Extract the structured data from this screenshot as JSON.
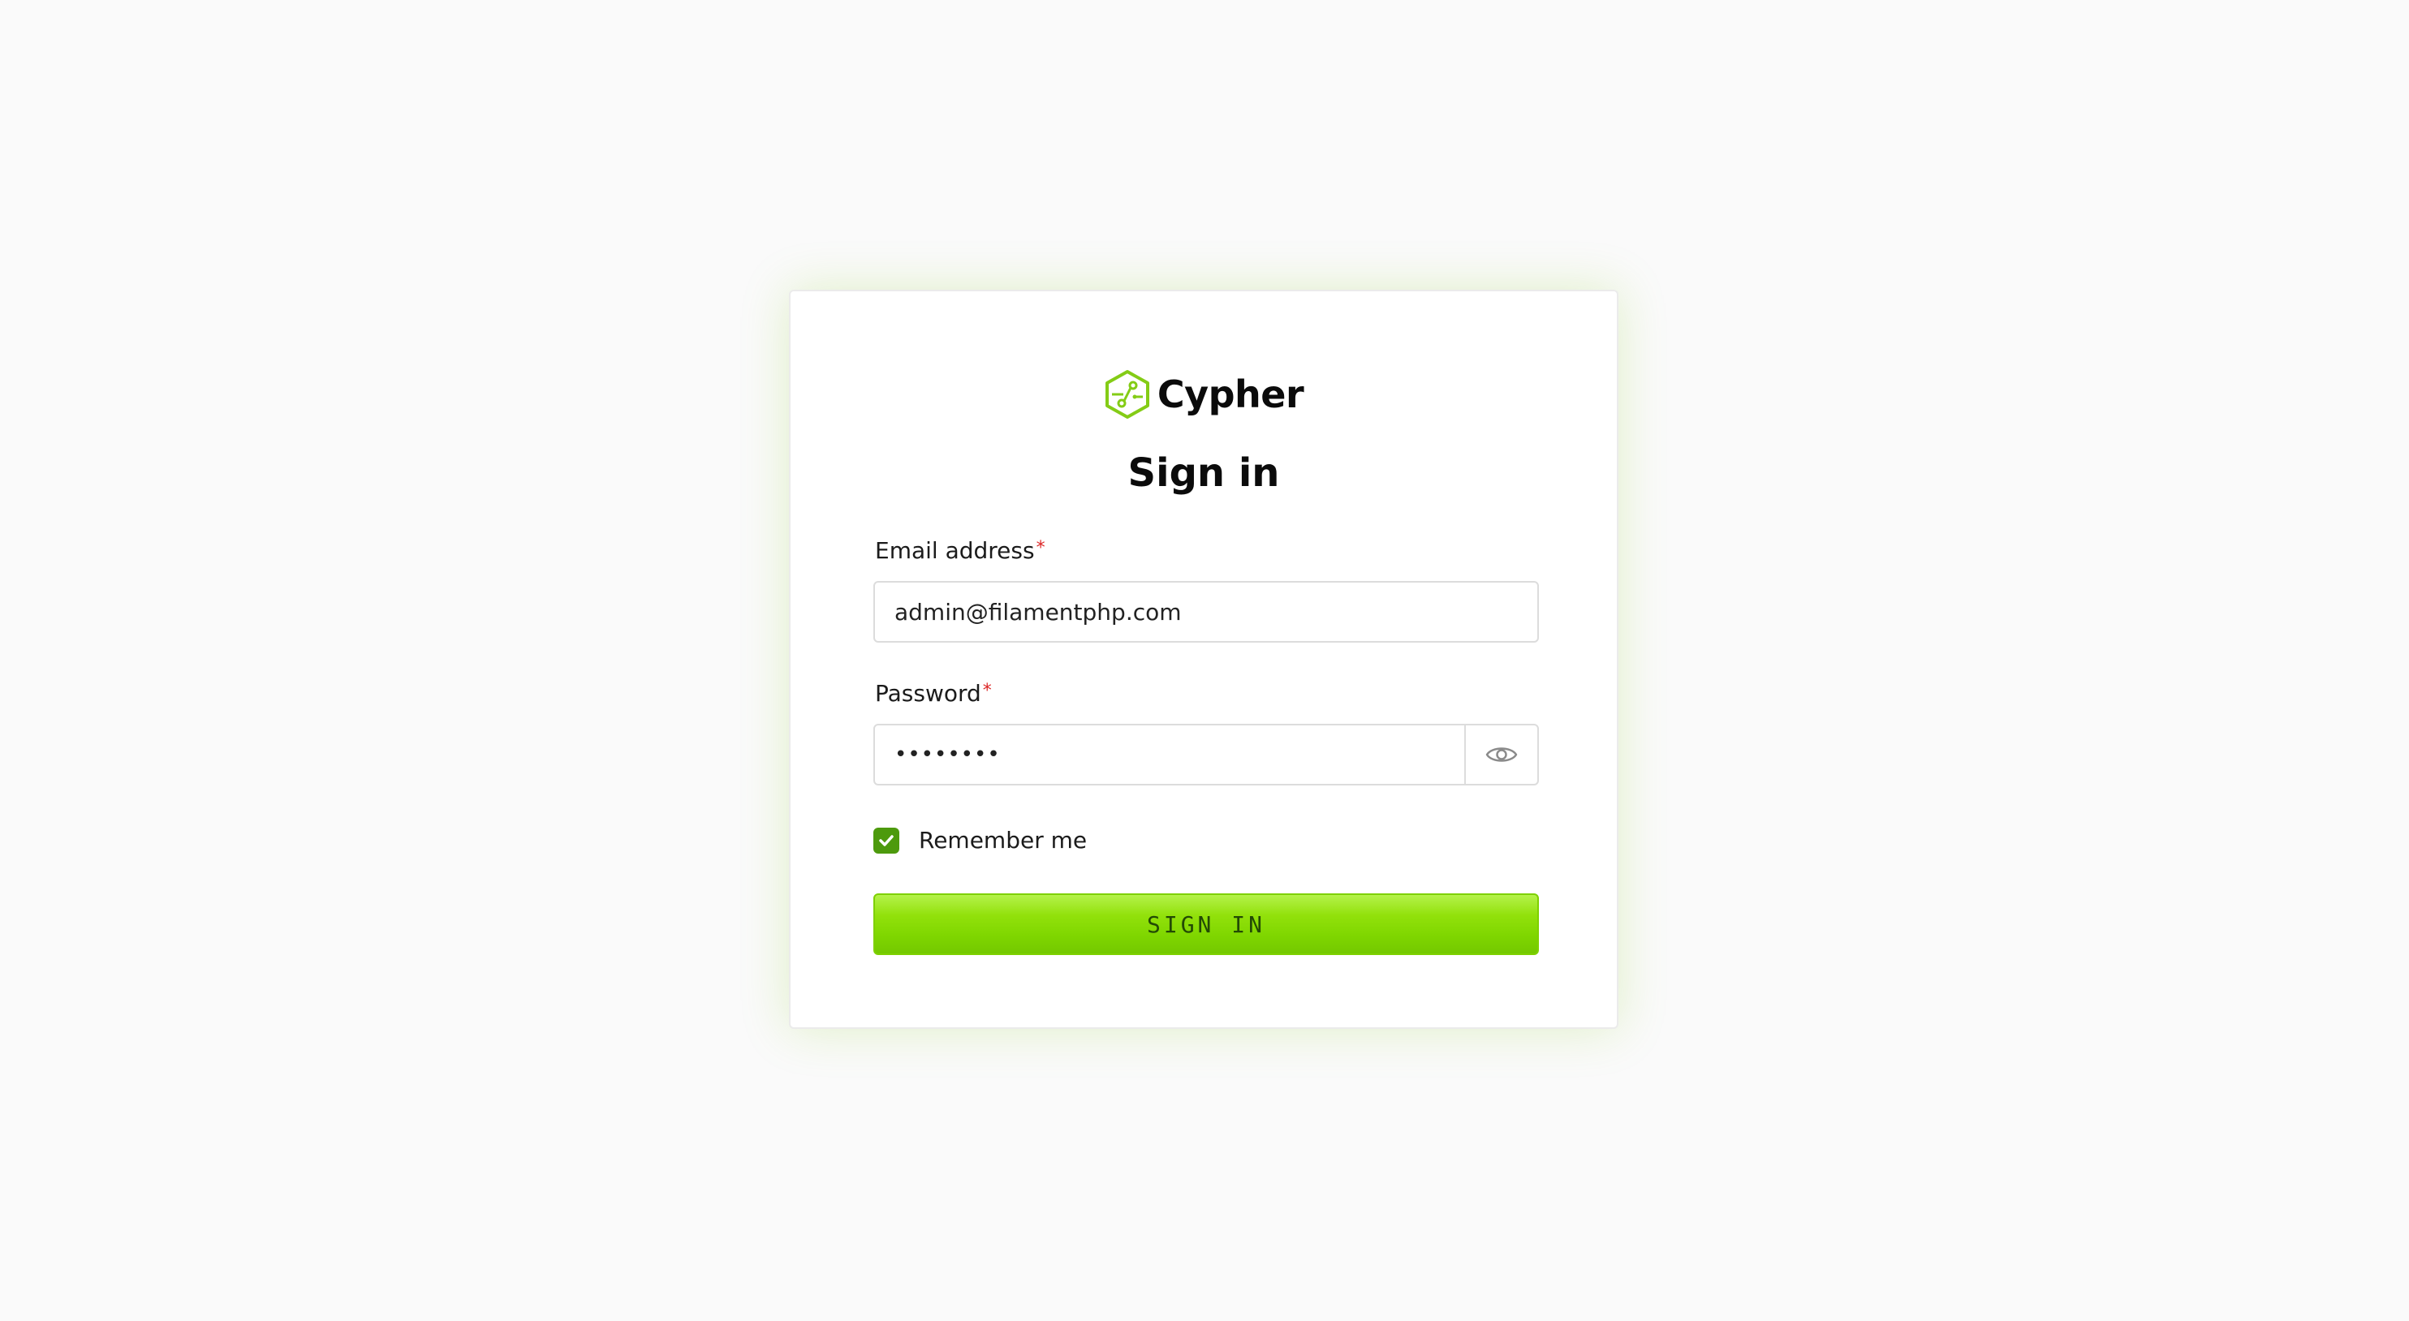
{
  "brand": {
    "name": "Cypher",
    "accent_color": "#84cc16",
    "logo_icon": "hexagon-circuit-icon"
  },
  "form": {
    "title": "Sign in",
    "email": {
      "label": "Email address",
      "required_mark": "*",
      "value": "admin@filamentphp.com"
    },
    "password": {
      "label": "Password",
      "required_mark": "*",
      "value": "••••••••",
      "toggle_icon": "eye-icon"
    },
    "remember": {
      "label": "Remember me",
      "checked": true
    },
    "submit_label": "SIGN IN"
  },
  "colors": {
    "page_background": "#fafafa",
    "card_background": "#ffffff",
    "checkbox": "#4d9a0d",
    "required": "#dc2626",
    "button_gradient_top": "#b5f24a",
    "button_gradient_bottom": "#74c800"
  }
}
